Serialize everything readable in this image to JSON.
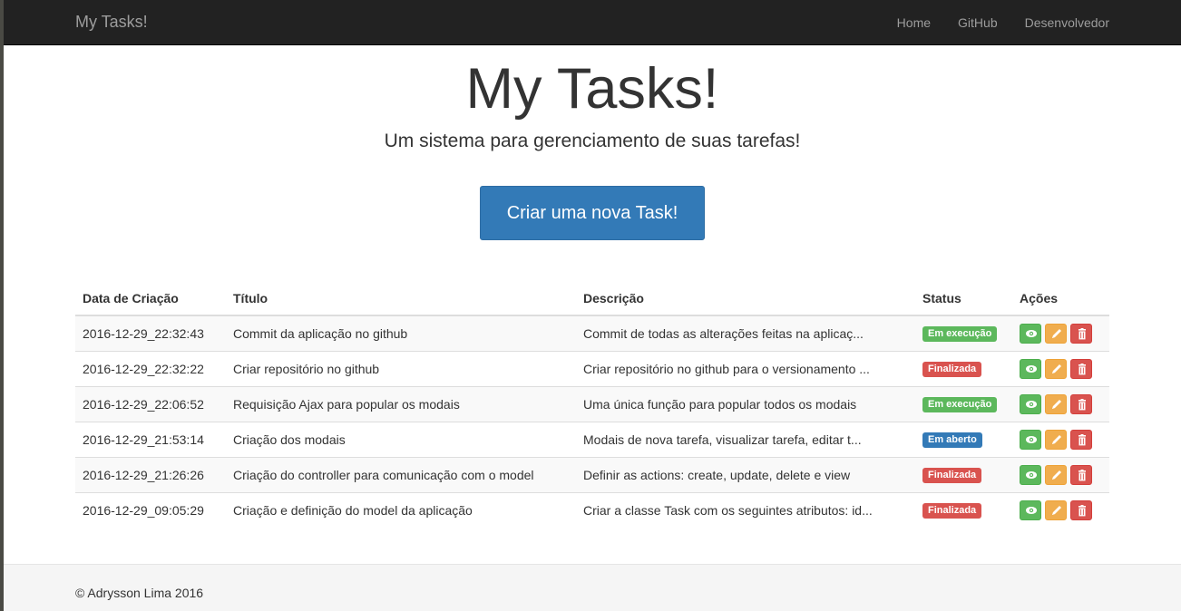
{
  "navbar": {
    "brand": "My Tasks!",
    "links": [
      "Home",
      "GitHub",
      "Desenvolvedor"
    ]
  },
  "hero": {
    "title": "My Tasks!",
    "subtitle": "Um sistema para gerenciamento de suas tarefas!",
    "cta_label": "Criar uma nova Task!"
  },
  "table": {
    "headers": [
      "Data de Criação",
      "Título",
      "Descrição",
      "Status",
      "Ações"
    ],
    "rows": [
      {
        "date": "2016-12-29_22:32:43",
        "title": "Commit da aplicação no github",
        "desc": "Commit de todas as alterações feitas na aplicaç...",
        "status": "Em execução",
        "status_color": "#5cb85c"
      },
      {
        "date": "2016-12-29_22:32:22",
        "title": "Criar repositório no github",
        "desc": "Criar repositório no github para o versionamento ...",
        "status": "Finalizada",
        "status_color": "#d9534f"
      },
      {
        "date": "2016-12-29_22:06:52",
        "title": "Requisição Ajax para popular os modais",
        "desc": "Uma única função para popular todos os modais",
        "status": "Em execução",
        "status_color": "#5cb85c"
      },
      {
        "date": "2016-12-29_21:53:14",
        "title": "Criação dos modais",
        "desc": "Modais de nova tarefa, visualizar tarefa, editar t...",
        "status": "Em aberto",
        "status_color": "#337ab7"
      },
      {
        "date": "2016-12-29_21:26:26",
        "title": "Criação do controller para comunicação com o model",
        "desc": "Definir as actions: create, update, delete e view",
        "status": "Finalizada",
        "status_color": "#d9534f"
      },
      {
        "date": "2016-12-29_09:05:29",
        "title": "Criação e definição do model da aplicação",
        "desc": "Criar a classe Task com os seguintes atributos: id...",
        "status": "Finalizada",
        "status_color": "#d9534f"
      }
    ],
    "action_icons": [
      "eye-icon",
      "pencil-icon",
      "trash-icon"
    ]
  },
  "footer": {
    "text": "© Adrysson Lima 2016"
  },
  "colors": {
    "navbar_bg": "#222222",
    "primary": "#337ab7",
    "success": "#5cb85c",
    "warning": "#f0ad4e",
    "danger": "#d9534f"
  }
}
